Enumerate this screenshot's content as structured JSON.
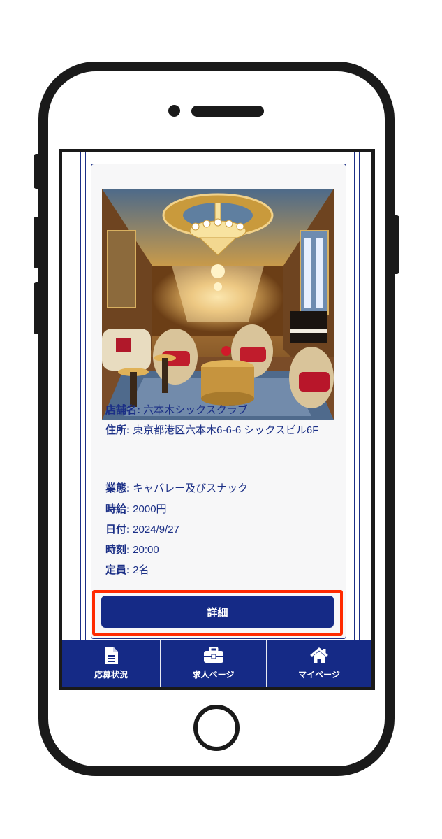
{
  "store": {
    "name_label": "店舗名:",
    "name": "六本木シックスクラブ",
    "address_label": "住所:",
    "address": "東京都港区六本木6-6-6 シックスビル6F",
    "business_label": "業態:",
    "business": "キャバレー及びスナック",
    "wage_label": "時給:",
    "wage": "2000円",
    "date_label": "日付:",
    "date": "2024/9/27",
    "time_label": "時刻:",
    "time": "20:00",
    "capacity_label": "定員:",
    "capacity": "2名"
  },
  "detail_button_label": "詳細",
  "nav": {
    "items": [
      {
        "label": "応募状況",
        "icon": "document-icon"
      },
      {
        "label": "求人ページ",
        "icon": "briefcase-icon"
      },
      {
        "label": "マイページ",
        "icon": "home-icon"
      }
    ]
  },
  "colors": {
    "primary": "#152a86",
    "highlight": "#ff2a00",
    "card_bg": "#f7f7f8"
  }
}
